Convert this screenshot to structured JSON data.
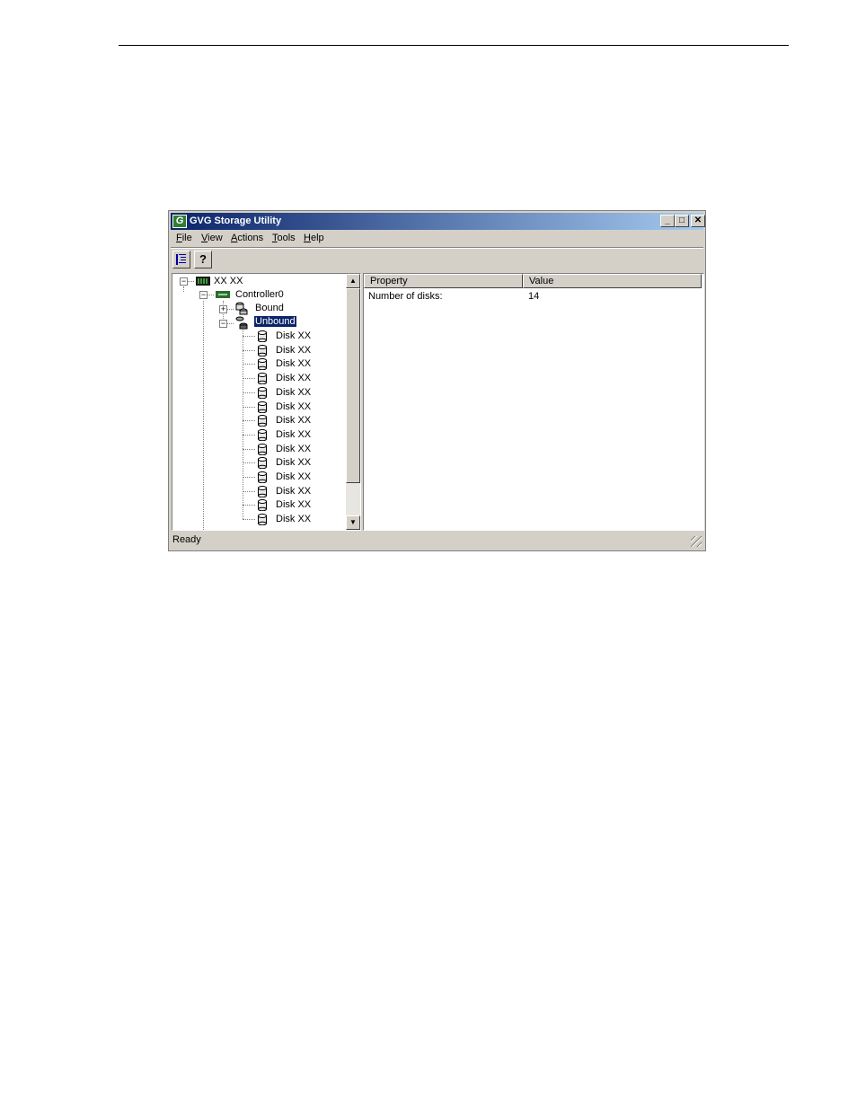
{
  "window": {
    "title": "GVG Storage Utility",
    "app_icon_glyph": "G",
    "controls": {
      "minimize": "_",
      "maximize": "□",
      "close": "✕"
    }
  },
  "menu": [
    {
      "label_underline": "F",
      "label_rest": "ile"
    },
    {
      "label_underline": "V",
      "label_rest": "iew"
    },
    {
      "label_underline": "A",
      "label_rest": "ctions"
    },
    {
      "label_underline": "T",
      "label_rest": "ools"
    },
    {
      "label_underline": "H",
      "label_rest": "elp"
    }
  ],
  "toolbar": {
    "buttons": [
      "tree-view-icon",
      "help-icon"
    ],
    "help_glyph": "?"
  },
  "tree": {
    "root_label": "XX XX",
    "controller_label": "Controller0",
    "bound_label": "Bound",
    "unbound_label": "Unbound",
    "disks": [
      "Disk XX",
      "Disk XX",
      "Disk XX",
      "Disk XX",
      "Disk XX",
      "Disk XX",
      "Disk XX",
      "Disk XX",
      "Disk XX",
      "Disk XX",
      "Disk XX",
      "Disk XX",
      "Disk XX",
      "Disk XX"
    ],
    "expanded_glyph": "−",
    "collapsed_glyph": "+"
  },
  "properties": {
    "headers": {
      "property": "Property",
      "value": "Value"
    },
    "rows": [
      {
        "property": "Number of disks:",
        "value": "14"
      }
    ]
  },
  "status": {
    "text": "Ready"
  },
  "scroll": {
    "up_glyph": "▲",
    "down_glyph": "▼"
  }
}
